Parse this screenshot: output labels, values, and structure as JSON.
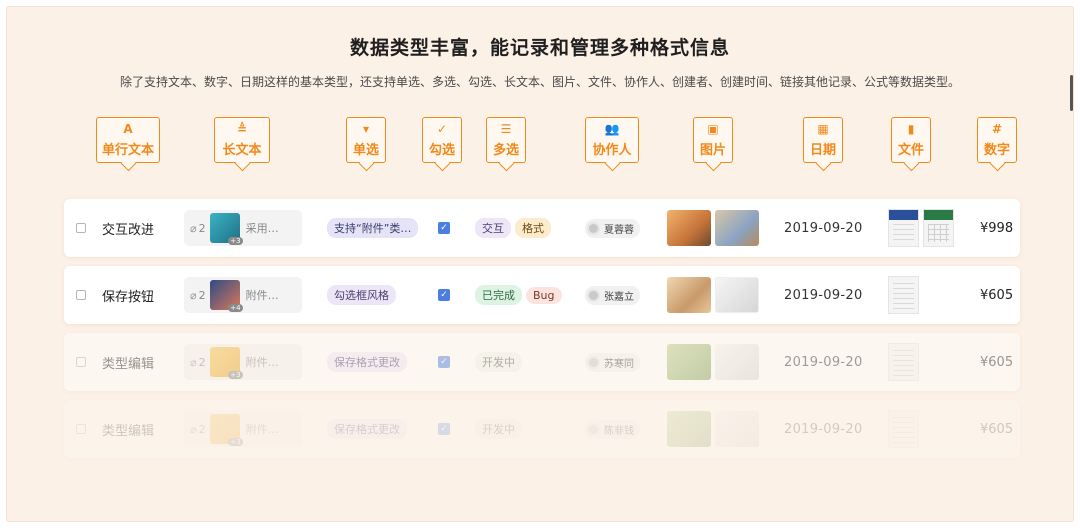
{
  "header": {
    "title": "数据类型丰富，能记录和管理多种格式信息",
    "subtitle": "除了支持文本、数字、日期这样的基本类型，还支持单选、多选、勾选、长文本、图片、文件、协作人、创建者、创建时间、链接其他记录、公式等数据类型。"
  },
  "field_types": [
    {
      "label": "单行文本",
      "icon": "A",
      "icon_name": "text-icon"
    },
    {
      "label": "长文本",
      "icon": "≜",
      "icon_name": "long-text-icon"
    },
    {
      "label": "单选",
      "icon": "▾",
      "icon_name": "single-select-icon"
    },
    {
      "label": "勾选",
      "icon": "✓",
      "icon_name": "checkbox-icon"
    },
    {
      "label": "多选",
      "icon": "☰",
      "icon_name": "multi-select-icon"
    },
    {
      "label": "协作人",
      "icon": "👥",
      "icon_name": "collaborator-icon"
    },
    {
      "label": "图片",
      "icon": "▣",
      "icon_name": "image-icon"
    },
    {
      "label": "日期",
      "icon": "▦",
      "icon_name": "calendar-icon"
    },
    {
      "label": "文件",
      "icon": "▮",
      "icon_name": "file-icon"
    },
    {
      "label": "数字",
      "icon": "#",
      "icon_name": "number-icon"
    }
  ],
  "colors": {
    "accent": "#f08a1c",
    "background": "#fcf1e7",
    "checkbox": "#4a7fe0",
    "word_blue": "#2b4f9a",
    "excel_green": "#2a7a46"
  },
  "rows": [
    {
      "name": "交互改进",
      "attachment_count": "2",
      "attachment_extra": "+3",
      "long_text": "采用…",
      "single_select": "支持“附件”类…",
      "checked": true,
      "tags": [
        "交互",
        "格式"
      ],
      "collaborator": "夏蓉蓉",
      "date": "2019-09-20",
      "price": "¥998"
    },
    {
      "name": "保存按钮",
      "attachment_count": "2",
      "attachment_extra": "+4",
      "long_text": "附件…",
      "single_select": "勾选框风格",
      "checked": true,
      "tags": [
        "已完成",
        "Bug"
      ],
      "collaborator": "张嘉立",
      "date": "2019-09-20",
      "price": "¥605"
    },
    {
      "name": "类型编辑",
      "attachment_count": "2",
      "attachment_extra": "+3",
      "long_text": "附件…",
      "single_select": "保存格式更改",
      "checked": true,
      "tags": [
        "开发中"
      ],
      "collaborator": "苏寒同",
      "date": "2019-09-20",
      "price": "¥605"
    },
    {
      "name": "类型编辑",
      "attachment_count": "2",
      "attachment_extra": "+3",
      "long_text": "附件…",
      "single_select": "保存格式更改",
      "checked": true,
      "tags": [
        "开发中"
      ],
      "collaborator": "陈非钱",
      "date": "2019-09-20",
      "price": "¥605"
    }
  ]
}
